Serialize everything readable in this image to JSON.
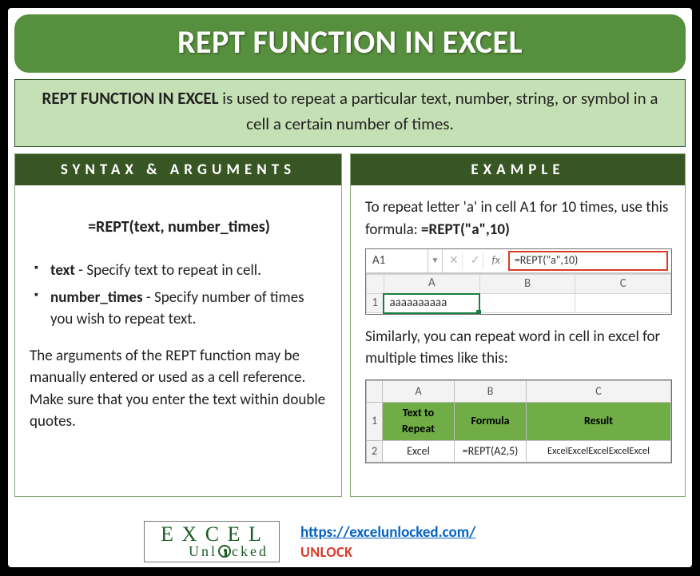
{
  "title": "REPT FUNCTION IN EXCEL",
  "intro": {
    "bold": "REPT FUNCTION IN EXCEL",
    "rest": " is used to repeat a particular text, number, string, or symbol in a cell a certain number of times."
  },
  "syntax": {
    "heading": "SYNTAX & ARGUMENTS",
    "formula": "=REPT(text, number_times)",
    "args": [
      {
        "name": "text",
        "desc": " - Specify text to repeat in cell."
      },
      {
        "name": "number_times",
        "desc": " - Specify number of times you wish to repeat text."
      }
    ],
    "note": "The arguments of the REPT function may be manually entered or used as a cell reference. Make sure that you enter the text within double quotes."
  },
  "example": {
    "heading": "EXAMPLE",
    "intro_a": "To repeat letter 'a' in cell A1 for 10 times, use this formula: ",
    "intro_b": "=REPT(\"a\",10)",
    "xl1": {
      "namebox": "A1",
      "formula": "=REPT(\"a\",10)",
      "cols": [
        "A",
        "B",
        "C"
      ],
      "row_label": "1",
      "cell_value": "aaaaaaaaaa"
    },
    "mid": "Similarly, you can repeat word in cell in excel for multiple times like this:",
    "xl2": {
      "cols": [
        "A",
        "B",
        "C"
      ],
      "header_row_label": "1",
      "headers": [
        "Text to Repeat",
        "Formula",
        "Result"
      ],
      "data_row_label": "2",
      "data": [
        "Excel",
        "=REPT(A2,5)",
        "ExcelExcelExcelExcelExcel"
      ]
    }
  },
  "footer": {
    "logo_top": "EXCEL",
    "logo_bottom": "Unlocked",
    "url": "https://excelunlocked.com/",
    "tag": "UNLOCK"
  }
}
